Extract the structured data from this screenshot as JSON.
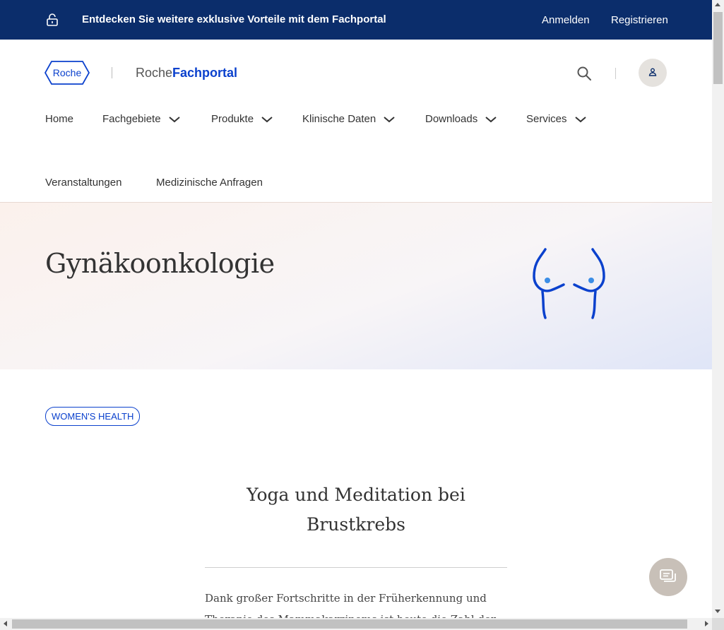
{
  "topbar": {
    "promo_text": "Entdecken Sie weitere exklusive Vorteile mit dem Fachportal",
    "login_label": "Anmelden",
    "register_label": "Registrieren",
    "background_color": "#0b2d6b"
  },
  "header": {
    "logo_text": "Roche",
    "brand_part1": "Roche",
    "brand_part2": "Fachportal",
    "search_icon": "search-icon",
    "user_icon": "user-icon",
    "accent_color": "#0b41cd"
  },
  "nav": {
    "items": [
      {
        "label": "Home",
        "has_dropdown": false
      },
      {
        "label": "Fachgebiete",
        "has_dropdown": true
      },
      {
        "label": "Produkte",
        "has_dropdown": true
      },
      {
        "label": "Klinische Daten",
        "has_dropdown": true
      },
      {
        "label": "Downloads",
        "has_dropdown": true
      },
      {
        "label": "Services",
        "has_dropdown": true
      },
      {
        "label": "Veranstaltungen",
        "has_dropdown": false
      },
      {
        "label": "Medizinische Anfragen",
        "has_dropdown": false
      }
    ]
  },
  "hero": {
    "title": "Gynäkoonkologie",
    "illustration_icon": "breast-illustration-icon"
  },
  "tag": {
    "label": "WOMEN'S HEALTH"
  },
  "article": {
    "title": "Yoga und Meditation bei Brustkrebs",
    "body": "Dank großer Fortschritte in der Früherkennung und Therapie des Mammakarzinoms ist heute die Zahl der"
  },
  "chat": {
    "icon": "chat-icon"
  }
}
